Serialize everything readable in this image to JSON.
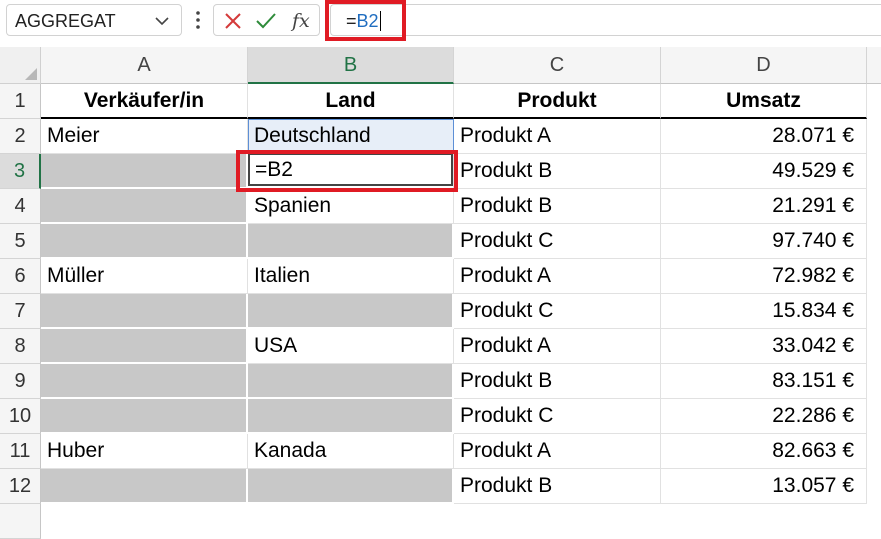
{
  "formula_bar": {
    "name_box": "AGGREGAT",
    "formula_eq": "=",
    "formula_ref": "B2"
  },
  "icons": {
    "name_box_dropdown": "chevron-down-icon",
    "more": "vertical-dots-icon",
    "cancel": "x-icon",
    "enter": "checkmark-icon",
    "function": "fx-icon"
  },
  "colors": {
    "highlight_red": "#e01b24",
    "selection_green": "#217346",
    "reference_blue": "#1f6dc0",
    "merged_gray": "#c8c8c8"
  },
  "fx_label": "fx",
  "columns": [
    "A",
    "B",
    "C",
    "D"
  ],
  "rows": [
    "1",
    "2",
    "3",
    "4",
    "5",
    "6",
    "7",
    "8",
    "9",
    "10",
    "11",
    "12"
  ],
  "table": {
    "headers": [
      "Verkäufer/in",
      "Land",
      "Produkt",
      "Umsatz"
    ],
    "rows": [
      [
        "Meier",
        "Deutschland",
        "Produkt A",
        "28.071 €"
      ],
      [
        "",
        "=B2",
        "Produkt B",
        "49.529 €"
      ],
      [
        "",
        "Spanien",
        "Produkt B",
        "21.291 €"
      ],
      [
        "",
        "",
        "Produkt C",
        "97.740 €"
      ],
      [
        "Müller",
        "Italien",
        "Produkt A",
        "72.982 €"
      ],
      [
        "",
        "",
        "Produkt C",
        "15.834 €"
      ],
      [
        "",
        "USA",
        "Produkt A",
        "33.042 €"
      ],
      [
        "",
        "",
        "Produkt B",
        "83.151 €"
      ],
      [
        "",
        "",
        "Produkt C",
        "22.286 €"
      ],
      [
        "Huber",
        "Kanada",
        "Produkt A",
        "82.663 €"
      ],
      [
        "",
        "",
        "Produkt B",
        "13.057 €"
      ]
    ]
  }
}
